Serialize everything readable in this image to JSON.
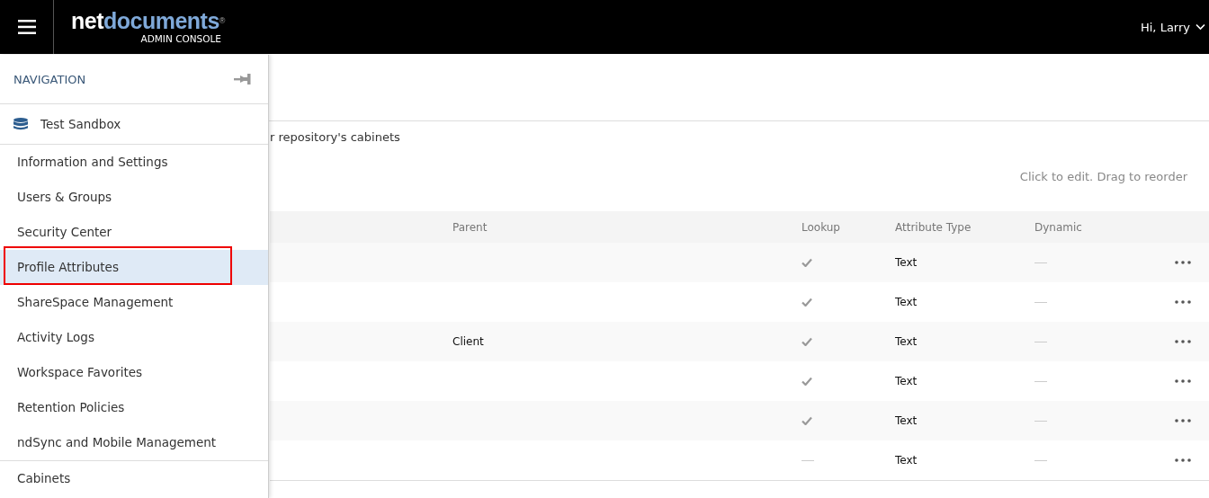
{
  "header": {
    "logo_part_1": "net",
    "logo_part_2": "documents",
    "logo_mark": "®",
    "logo_subtitle": "ADMIN CONSOLE",
    "greeting": "Hi, Larry"
  },
  "page": {
    "description": "r repository's cabinets",
    "hint": "Click to edit. Drag to reorder"
  },
  "table": {
    "columns": [
      "Parent",
      "Lookup",
      "Attribute Type",
      "Dynamic"
    ],
    "rows": [
      {
        "parent": "",
        "lookup": true,
        "attribute_type": "Text",
        "dynamic": false
      },
      {
        "parent": "",
        "lookup": true,
        "attribute_type": "Text",
        "dynamic": false
      },
      {
        "parent": "Client",
        "lookup": true,
        "attribute_type": "Text",
        "dynamic": false
      },
      {
        "parent": "",
        "lookup": true,
        "attribute_type": "Text",
        "dynamic": false
      },
      {
        "parent": "",
        "lookup": true,
        "attribute_type": "Text",
        "dynamic": false
      },
      {
        "parent": "",
        "lookup": false,
        "attribute_type": "Text",
        "dynamic": false
      }
    ]
  },
  "navigation": {
    "title": "NAVIGATION",
    "repository": "Test Sandbox",
    "groups": [
      {
        "items": [
          {
            "label": "Information and Settings",
            "selected": false,
            "annotated": false
          },
          {
            "label": "Users & Groups",
            "selected": false,
            "annotated": false
          },
          {
            "label": "Security Center",
            "selected": false,
            "annotated": false
          },
          {
            "label": "Profile Attributes",
            "selected": true,
            "annotated": true
          },
          {
            "label": "ShareSpace Management",
            "selected": false,
            "annotated": false
          },
          {
            "label": "Activity Logs",
            "selected": false,
            "annotated": false
          },
          {
            "label": "Workspace Favorites",
            "selected": false,
            "annotated": false
          },
          {
            "label": "Retention Policies",
            "selected": false,
            "annotated": false
          },
          {
            "label": "ndSync and Mobile Management",
            "selected": false,
            "annotated": false
          }
        ]
      },
      {
        "items": [
          {
            "label": "Cabinets",
            "selected": false,
            "annotated": false
          }
        ]
      }
    ]
  }
}
